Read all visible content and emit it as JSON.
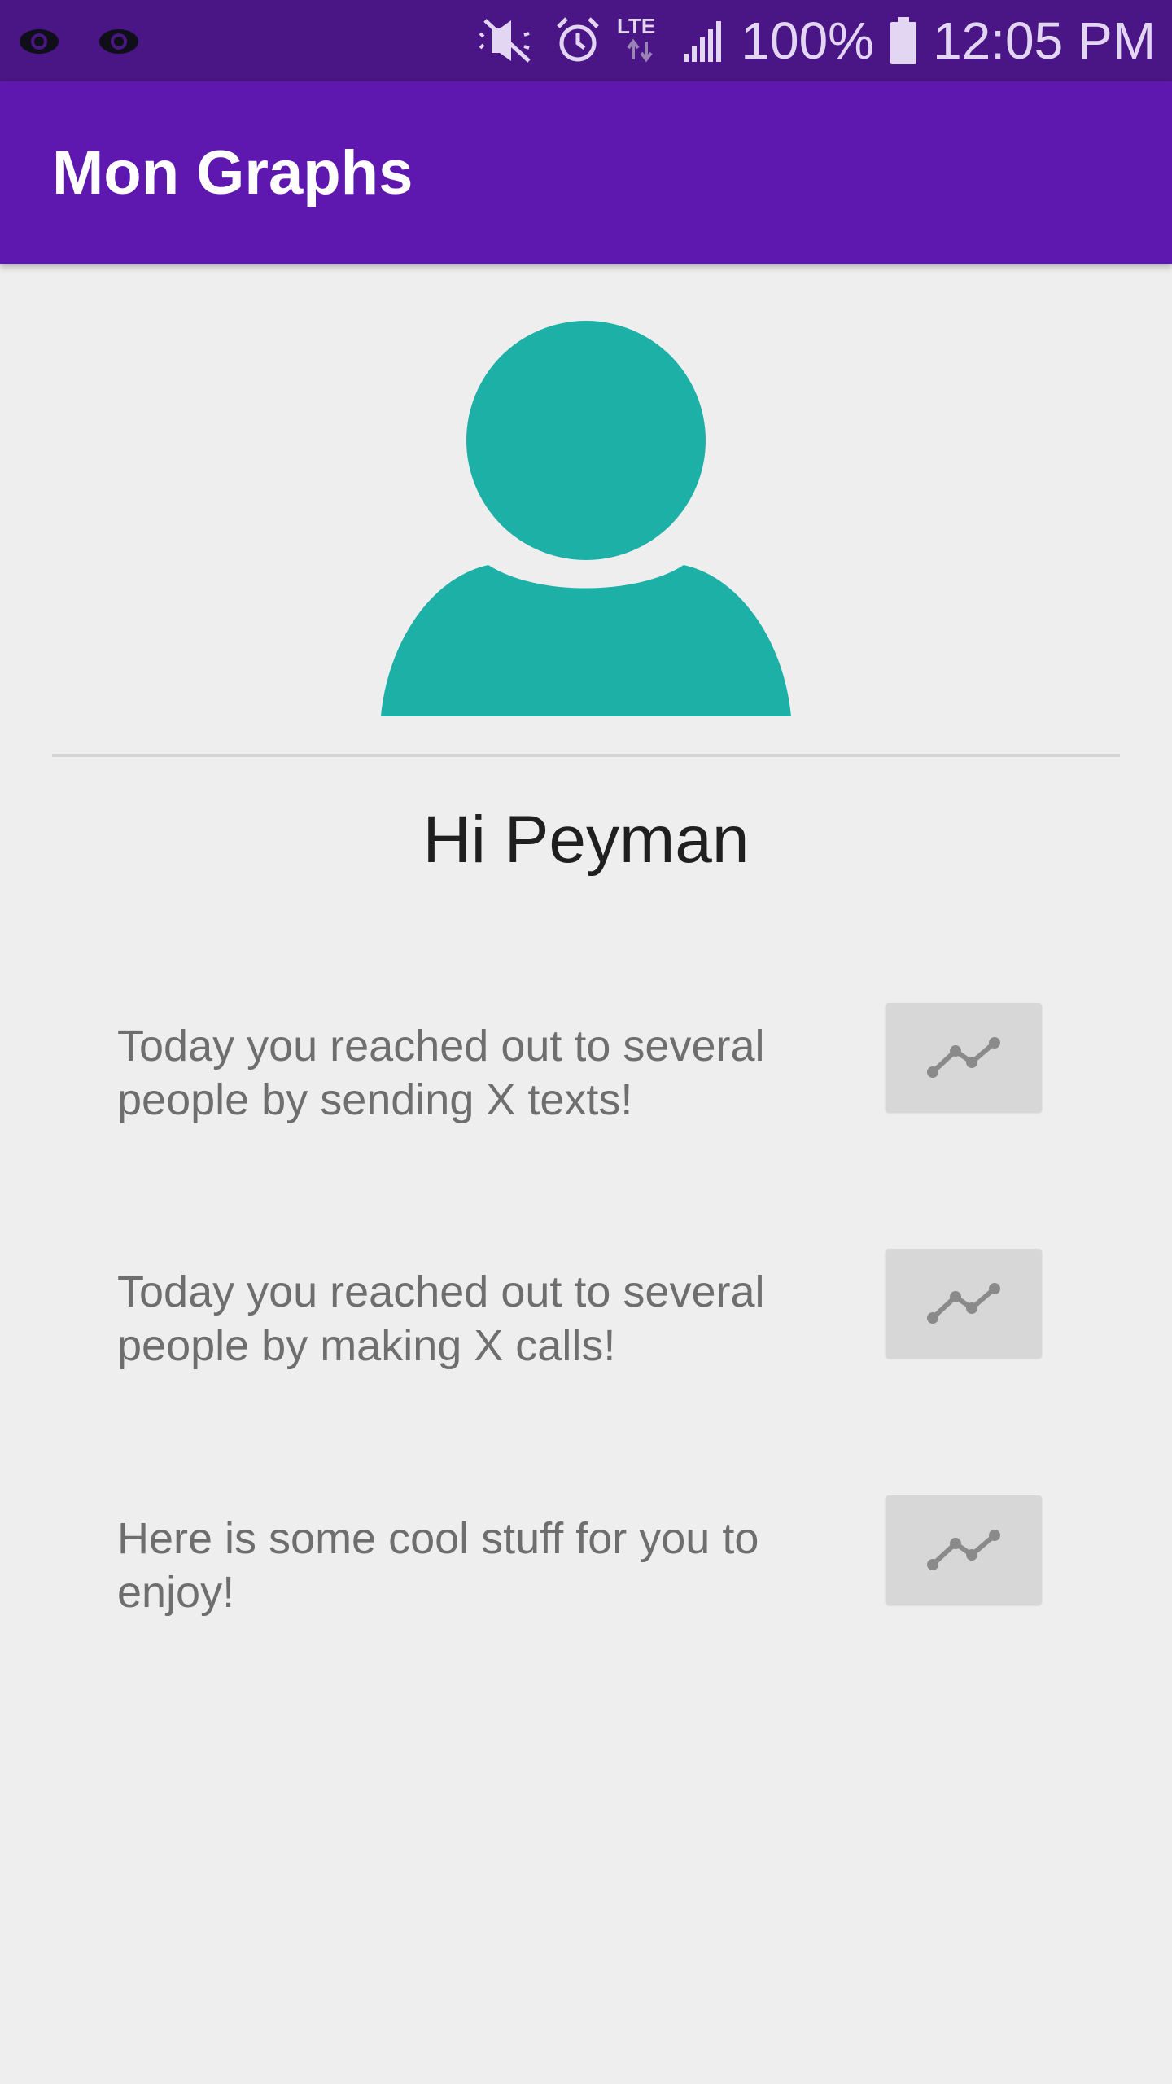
{
  "status_bar": {
    "battery": "100%",
    "time": "12:05 PM",
    "network": "LTE",
    "icons": [
      "eye-icon",
      "eye-icon",
      "muted-icon",
      "alarm-icon",
      "lte-data-icon",
      "signal-icon",
      "battery-icon"
    ]
  },
  "app_bar": {
    "title": "Mon Graphs"
  },
  "profile": {
    "greeting": "Hi Peyman",
    "avatar_icon": "person-icon",
    "avatar_color": "#1cb0a7"
  },
  "cards": [
    {
      "text": "Today you reached out to several people by sending X texts!",
      "button_icon": "line-chart-icon"
    },
    {
      "text": "Today you reached out to several people by making X calls!",
      "button_icon": "line-chart-icon"
    },
    {
      "text": "Here is some cool stuff for you to enjoy!",
      "button_icon": "line-chart-icon"
    }
  ],
  "colors": {
    "status_bar": "#4a1584",
    "app_bar": "#5e18b0",
    "background": "#eeeeef",
    "button": "#d7d7d7"
  }
}
